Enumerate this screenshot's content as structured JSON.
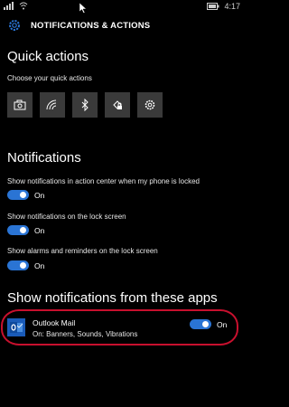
{
  "status_bar": {
    "time": "4:17"
  },
  "header": {
    "title": "NOTIFICATIONS & ACTIONS"
  },
  "quick_actions": {
    "heading": "Quick actions",
    "subtitle": "Choose your quick actions",
    "buttons": [
      {
        "icon": "camera-icon"
      },
      {
        "icon": "wifi-icon"
      },
      {
        "icon": "bluetooth-icon"
      },
      {
        "icon": "rotation-lock-icon"
      },
      {
        "icon": "settings-icon"
      }
    ]
  },
  "notifications": {
    "heading": "Notifications",
    "items": [
      {
        "label": "Show notifications in action center when my phone is locked",
        "state": "On",
        "enabled": true
      },
      {
        "label": "Show notifications on the lock screen",
        "state": "On",
        "enabled": true
      },
      {
        "label": "Show alarms and reminders on the lock screen",
        "state": "On",
        "enabled": true
      }
    ]
  },
  "apps": {
    "heading": "Show notifications from these apps",
    "items": [
      {
        "name": "Outlook Mail",
        "detail": "On: Banners, Sounds, Vibrations",
        "state": "On",
        "enabled": true,
        "icon": "outlook-mail-icon"
      }
    ]
  },
  "colors": {
    "accent": "#2a74d4",
    "highlight": "#c8102e",
    "tile": "#3a3a3a",
    "background": "#000000"
  }
}
